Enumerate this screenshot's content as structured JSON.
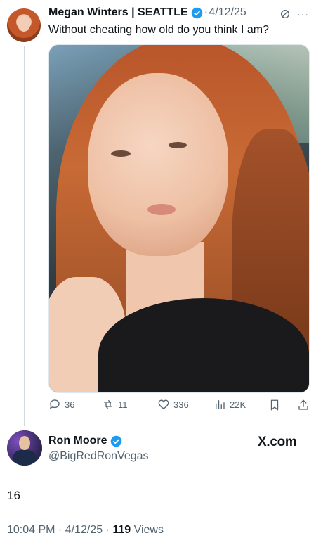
{
  "tweet": {
    "author_name": "Megan Winters | SEATTLE",
    "date": "4/12/25",
    "text": "Without cheating how old do you think I am?",
    "stats": {
      "replies": "36",
      "reposts": "11",
      "likes": "336",
      "views": "22K"
    }
  },
  "reply": {
    "author_name": "Ron Moore",
    "handle": "@BigRedRonVegas",
    "text": "16",
    "time": "10:04 PM",
    "date": "4/12/25",
    "views_count": "119",
    "views_label": "Views"
  },
  "branding": {
    "site": "X.com"
  },
  "colors": {
    "verified": "#1d9bf0",
    "muted_text": "#536471",
    "thread_line": "#cfd9de"
  }
}
